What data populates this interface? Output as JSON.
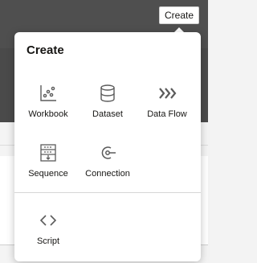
{
  "header": {
    "create_button_label": "Create"
  },
  "popup": {
    "title": "Create",
    "items": [
      {
        "label": "Workbook",
        "icon": "workbook-icon"
      },
      {
        "label": "Dataset",
        "icon": "dataset-icon"
      },
      {
        "label": "Data Flow",
        "icon": "data-flow-icon"
      },
      {
        "label": "Sequence",
        "icon": "sequence-icon"
      },
      {
        "label": "Connection",
        "icon": "connection-icon"
      },
      {
        "label": "Script",
        "icon": "script-icon"
      }
    ]
  },
  "colors": {
    "text": "#161513",
    "icon": "#5b5b5b",
    "header_bg": "#4f4f4f"
  }
}
